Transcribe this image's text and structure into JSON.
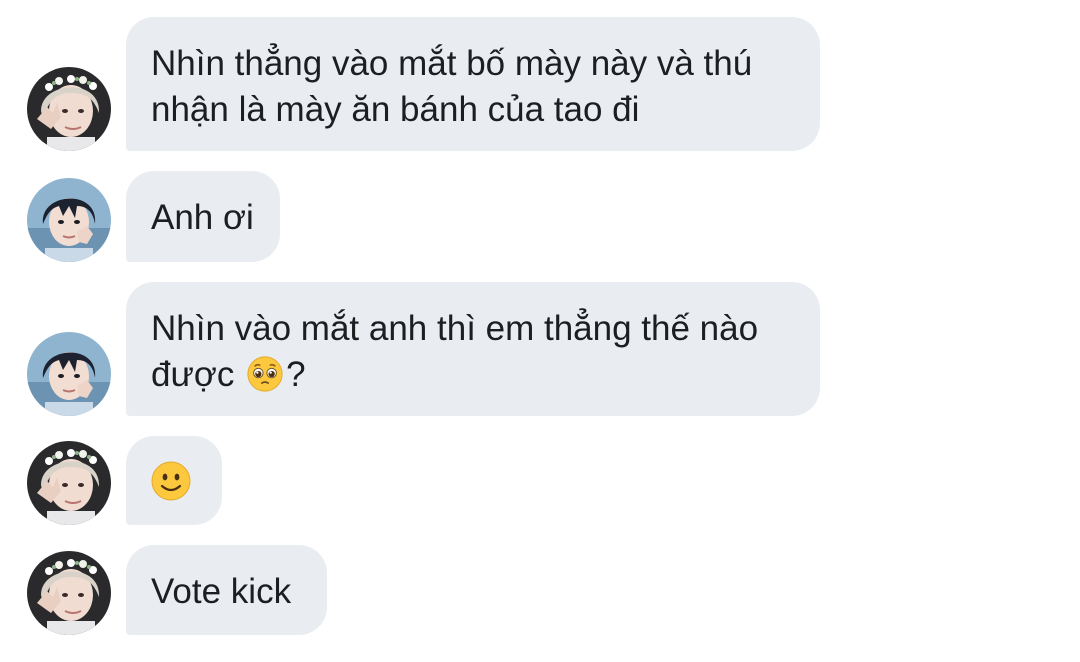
{
  "conversation": {
    "messages": [
      {
        "sender_avatar": "avatar-blonde-flower-crown",
        "lines": [
          "Nhìn thẳng vào mắt bố mày này và thú",
          "nhận là mày ăn bánh của tao đi"
        ]
      },
      {
        "sender_avatar": "avatar-dark-hair",
        "lines": [
          "Anh ơi"
        ]
      },
      {
        "sender_avatar": "avatar-dark-hair",
        "lines": [
          "Nhìn vào mắt anh thì em thẳng thế nào"
        ],
        "line2_text": "được",
        "line2_emoji": "pleading-face-emoji",
        "line2_suffix": "?"
      },
      {
        "sender_avatar": "avatar-blonde-flower-crown",
        "emoji": "slightly-smiling-face-emoji"
      },
      {
        "sender_avatar": "avatar-blonde-flower-crown",
        "lines": [
          "Vote kick"
        ]
      }
    ]
  },
  "colors": {
    "bubble_bg": "#e9ecf0",
    "text": "#1c1e21",
    "emoji_yellow": "#fcc93e"
  }
}
